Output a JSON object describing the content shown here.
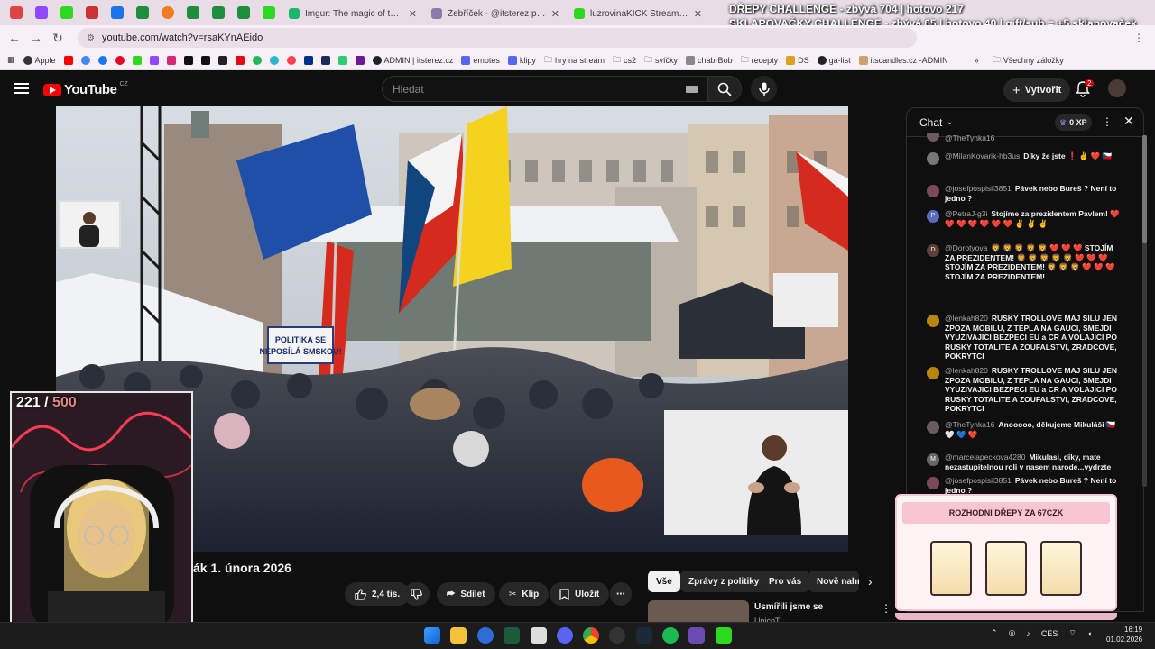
{
  "browser": {
    "pinned_tabs": [
      {
        "icon": "gmail-icon",
        "color": "#d44"
      },
      {
        "icon": "twitch-icon",
        "color": "#9146ff"
      },
      {
        "icon": "kick-icon",
        "color": "#2bd91f"
      },
      {
        "icon": "gmail-icon",
        "color": "#c33"
      },
      {
        "icon": "calendar-icon",
        "color": "#1a73e8"
      },
      {
        "icon": "sheets-plus-icon",
        "color": "#1e8e3e"
      },
      {
        "icon": "orange-icon",
        "color": "#f27a24"
      },
      {
        "icon": "sheets-plus-icon",
        "color": "#1e8e3e"
      },
      {
        "icon": "sheets-plus-icon",
        "color": "#1e8e3e"
      },
      {
        "icon": "sheets-plus-icon",
        "color": "#1e8e3e"
      },
      {
        "icon": "kick-icon",
        "color": "#2bd91f"
      }
    ],
    "tabs": [
      {
        "title": "Imgur: The magic of the Interne",
        "icon": "imgur-icon",
        "color": "#1bb76e",
        "active": false
      },
      {
        "title": "Žebříček - @itsterez panel",
        "icon": "panel-icon",
        "color": "#8a7ca8",
        "active": false
      },
      {
        "title": "luzrovinaKICK Stream - Watch",
        "icon": "kick-icon",
        "color": "#2bd91f",
        "active": false
      }
    ],
    "url": "youtube.com/watch?v=rsaKYnAEido",
    "bookmarks": [
      "Apple",
      "",
      "",
      "",
      "",
      "",
      "",
      "",
      "",
      "",
      "",
      "",
      "",
      "",
      "",
      "",
      "",
      "",
      "",
      "ADMIN | itsterez.cz",
      "emotes",
      "klipy",
      "hry na stream",
      "cs2",
      "svíčky",
      "chabrBob",
      "recepty",
      "DS",
      "ga-list",
      "itscandles.cz -ADMIN"
    ],
    "bookmarks_overflow": "»",
    "all_bookmarks": "Všechny záložky"
  },
  "stream_overlay": {
    "line1": "DŘEPY CHALLENGE - zbývá 704 | hotovo 217",
    "line2": "SKLAPOVAČKY CHALLENGE - zbývá 65 | hotovo 40 | gift/sub = +5 sklapovaček",
    "counter_current": "221",
    "counter_sep": " / ",
    "counter_max": "500"
  },
  "youtube": {
    "logo_text": "YouTube",
    "logo_region": "CZ",
    "search_placeholder": "Hledat",
    "create_label": "Vytvořit",
    "notification_count": "2",
    "video_title_fragment": "ák 1. února 2026",
    "sign_on_screen": "POLITIKA SE NEPOSÍLÁ SMSKOU!",
    "actions": {
      "likes": "2,4 tis.",
      "share": "Sdílet",
      "clip": "Klip",
      "save": "Uložit"
    },
    "chips": [
      "Vše",
      "Zprávy z politiky",
      "Pro vás",
      "Nově nahr"
    ],
    "recommended": {
      "title": "Usmířili jsme se",
      "channel": "UnicoT..."
    }
  },
  "chat": {
    "header": "Chat",
    "xp": "0 XP",
    "messages": [
      {
        "author": "@TheTynka16",
        "text": "",
        "avatar_color": "#6b5a60"
      },
      {
        "author": "@MilanKovarik-hb3us",
        "text": "Díky že jste ❗ ✌️ ❤️ 🇨🇿",
        "avatar_color": "#777"
      },
      {
        "author": "@josefpospisil3851",
        "text": "Pávek nebo Bureš ? Není to jedno ?",
        "avatar_color": "#7a4a58"
      },
      {
        "author": "@PetraJ-g3i",
        "text": "Stojíme za prezidentem Pavlem! ❤️ ❤️ ❤️ ❤️ ❤️ ❤️ ❤️ ✌️ ✌️ ✌️",
        "avatar_color": "#5c6bc0",
        "avatar_letter": "P"
      },
      {
        "author": "@Dorotyova",
        "text": "🦁 🦁 🦁 🦁 🦁 ❤️ ❤️ ❤️ STOJÍM ZA PREZIDENTEM! 🦁 🦁 🦁 🦁 🦁 ❤️ ❤️ ❤️ STOJÍM ZA PREZIDENTEM! 🦁 🦁 🦁 ❤️ ❤️ ❤️ STOJÍM ZA PREZIDENTEM!",
        "avatar_color": "#5d4037",
        "avatar_letter": "D"
      },
      {
        "author": "@lenkah820",
        "text": "RUSKY TROLLOVE MAJ SILU JEN ZPOZA MOBILU, Z TEPLA NA GAUCI, SMEJDI VYUZIVAJICI BEZPECI EU a CR A VOLAJICI PO RUSKY TOTALITE A ZOUFALSTVI, ZRADCOVE, POKRYTCI",
        "avatar_color": "#b8860b"
      },
      {
        "author": "@lenkah820",
        "text": "RUSKY TROLLOVE MAJ SILU JEN ZPOZA MOBILU, Z TEPLA NA GAUCI, SMEJDI VYUZIVAJICI BEZPECI EU a CR A VOLAJICI PO RUSKY TOTALITE A ZOUFALSTVI, ZRADCOVE, POKRYTCI",
        "avatar_color": "#b8860b"
      },
      {
        "author": "@TheTynka16",
        "text": "Anooooo, děkujeme Mikuláši 🇨🇿 🤍 💙 ❤️",
        "avatar_color": "#6b5a60"
      },
      {
        "author": "@marcelapeckova4280",
        "text": "Mikulasi, diky, mate nezastupitelnou roli v nasem narode...vydrzte",
        "avatar_color": "#666",
        "avatar_letter": "M"
      },
      {
        "author": "@josefpospisil3851",
        "text": "Pávek nebo Bureš ? Není to jedno ?",
        "avatar_color": "#7a4a58"
      }
    ]
  },
  "game_widget": {
    "title": "ROZHODNI DŘEPY ZA 67CZK",
    "cards": [
      "",
      "",
      ""
    ]
  },
  "taskbar": {
    "language": "CES",
    "time": "16:19",
    "date": "01.02.2026"
  },
  "colors": {
    "youtube_red": "#ff0000",
    "chat_bg": "#0f0f0f",
    "widget_pink": "#f7c5d3"
  }
}
